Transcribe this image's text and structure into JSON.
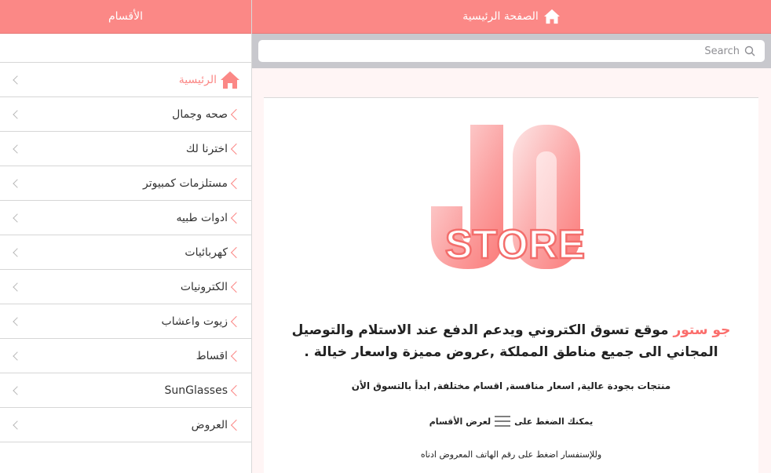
{
  "sidebar": {
    "title": "الأقسام",
    "items": [
      {
        "label": "الرئيسية",
        "icon": "home-icon",
        "active": true
      },
      {
        "label": "صحه وجمال"
      },
      {
        "label": "اخترنا لك"
      },
      {
        "label": "مستلزمات كمبيوتر"
      },
      {
        "label": "ادوات طبيه"
      },
      {
        "label": "كهربائيات"
      },
      {
        "label": "الكترونيات"
      },
      {
        "label": "زيوت واعشاب"
      },
      {
        "label": "اقساط"
      },
      {
        "label": "SunGlasses"
      },
      {
        "label": "العروض"
      }
    ]
  },
  "header": {
    "title": "الصفحة الرئيسية",
    "icon": "home-icon"
  },
  "search": {
    "placeholder": "Search"
  },
  "content": {
    "logo_top": "JO",
    "logo_bottom": "STORE",
    "brand": "جو ستور",
    "intro": "موقع تسوق الكتروني ويدعم الدفع عند الاستلام والتوصيل المجاني الى جميع مناطق المملكة ,عروض مميزة واسعار خيالة .",
    "features": "منتجات بجودة عالية, اسعار منافسة, اقسام مختلفة, ابدأ بالتسوق الأن",
    "hint_before": "يمكنك الضغط على",
    "hint_after": "لعرض الأقسام",
    "contact": "وللإستفسار اضغط على رقم الهاتف المعروض ادناه"
  },
  "colors": {
    "accent": "#fb8886",
    "brand_text": "#fb6e6c",
    "search_bar_bg": "#c8c8cd"
  }
}
